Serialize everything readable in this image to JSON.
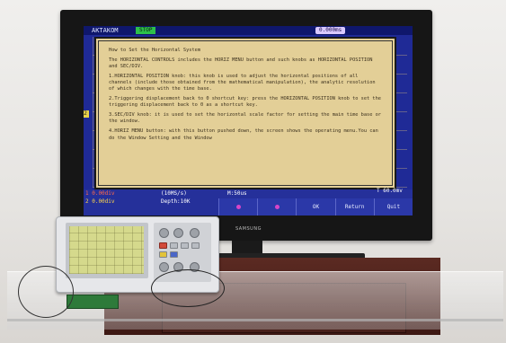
{
  "tv": {
    "brand": "SAMSUNG"
  },
  "scope_ui": {
    "top_bar": {
      "brand": "AKTAKOM",
      "mode": "STOP",
      "time_offset": "0.000ms"
    },
    "help": {
      "title": "How to Set the Horizontal System",
      "paragraphs": [
        "The HORIZONTAL CONTROLS includes the HORIZ MENU button and such knobs as HORIZONTAL POSITION and SEC/DIV.",
        "1.HORIZONTAL POSITION knob: this knob is used to adjust the horizontal positions of all channels (include those obtained from the mathematical manipulation), the analytic resolution of which changes with the time base.",
        "2.Triggering displacement back to 0 shortcut key: press the HORIZONTAL POSITION knob to set the triggering displacement back to 0 as a shortcut key.",
        "3.SEC/DIV knob: it is used to set the horizontal scale factor for setting the main time base or the window.",
        "4.HORIZ MENU button: with this button pushed down, the screen shows the operating menu.You can do the Window Setting and the Window"
      ],
      "left_marker": "2"
    },
    "status": {
      "ch1": "1 0.00div",
      "ch2": "2 0.00div",
      "acquire": "(10MS/s)",
      "depth": "Depth:10K",
      "timebase": "M:50us",
      "trigger": "T 60.0mv"
    },
    "softkeys": [
      {
        "label": "",
        "type": "dot"
      },
      {
        "label": "",
        "type": "dot"
      },
      {
        "label": "OK",
        "type": "text"
      },
      {
        "label": "Return",
        "type": "text"
      },
      {
        "label": "Quit",
        "type": "text"
      }
    ],
    "colors": {
      "screen_bg": "#1f2a96",
      "panel_bg": "#e3cf97",
      "ch1": "#ff6a4a",
      "ch2": "#ffd64a",
      "mode_badge": "#2ec04a"
    }
  },
  "scope_device": {
    "label": "Oscilloscope"
  }
}
